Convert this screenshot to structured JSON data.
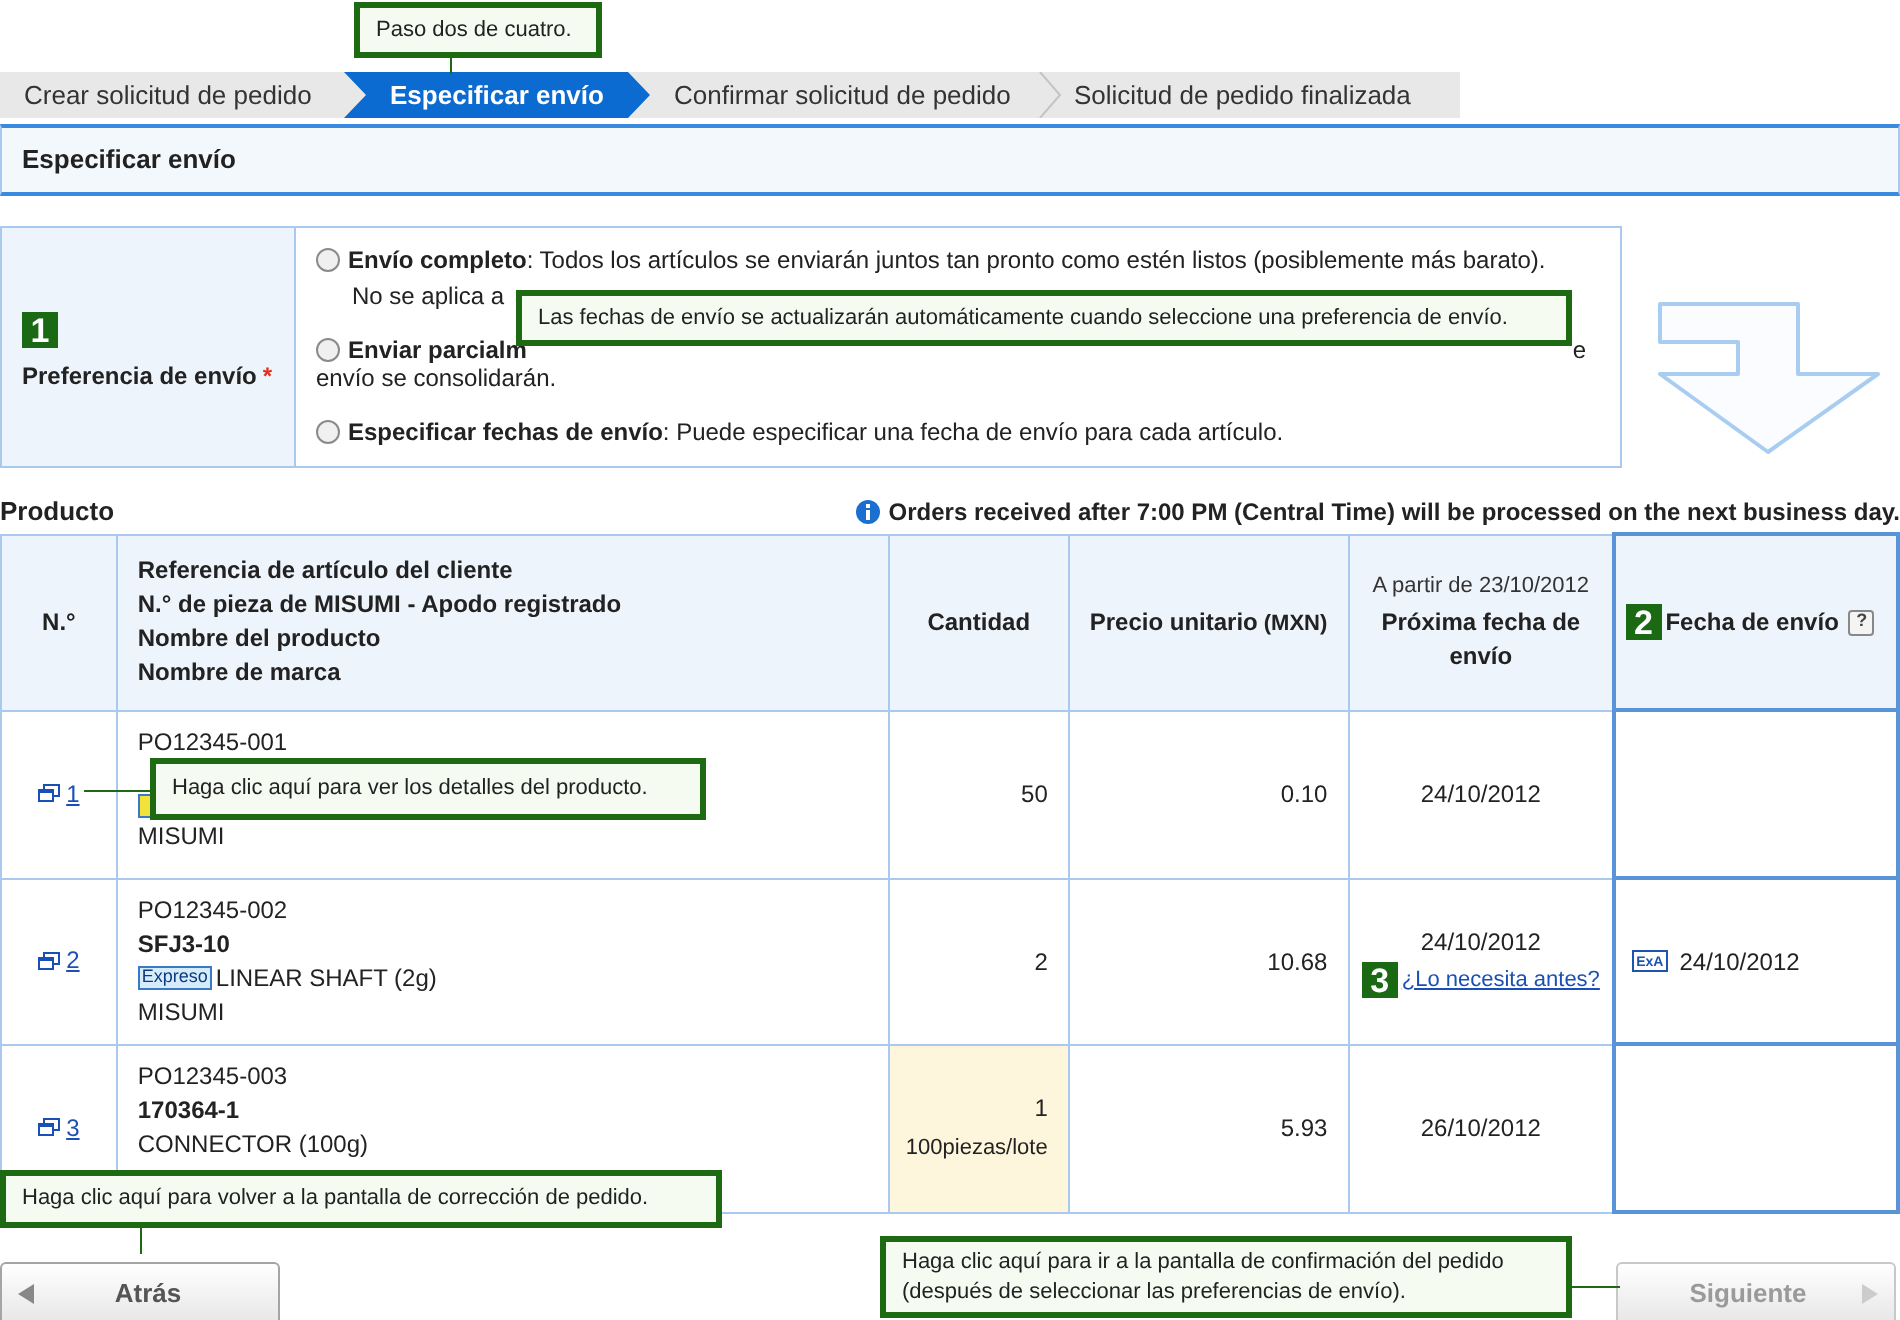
{
  "steps": [
    {
      "label": "Crear solicitud de pedido",
      "selected": false
    },
    {
      "label": "Especificar envío",
      "selected": true
    },
    {
      "label": "Confirmar solicitud de pedido",
      "selected": false
    },
    {
      "label": "Solicitud de pedido finalizada",
      "selected": false
    }
  ],
  "step_callout": "Paso dos de cuatro.",
  "section_title": "Especificar envío",
  "preference": {
    "marker": "1",
    "label": "Preferencia de envío",
    "required_mark": "*",
    "options": [
      {
        "kind": "full",
        "selected": false,
        "title": "Envío completo",
        "text": ": Todos los artículos se enviarán juntos tan pronto como estén listos (posiblemente más barato).",
        "note": "No se aplica a"
      },
      {
        "kind": "partial",
        "selected": false,
        "title": "Enviar parcialm",
        "tail": "e",
        "note": "envío se consolidarán."
      },
      {
        "kind": "dates",
        "selected": false,
        "title": "Especificar fechas de envío",
        "text": ": Puede especificar una fecha de envío para cada artículo."
      }
    ],
    "callout": "Las fechas de envío se actualizarán automáticamente cuando seleccione una preferencia de envío."
  },
  "table": {
    "title": "Producto",
    "notice": "Orders received after 7:00 PM (Central Time) will be processed on the next business day.",
    "columns": [
      {
        "lines": [
          "N.°"
        ]
      },
      {
        "lines": [
          "Referencia de artículo del cliente",
          "N.° de pieza de MISUMI - Apodo registrado",
          "Nombre del producto",
          "Nombre de marca"
        ]
      },
      {
        "lines": [
          "Cantidad"
        ]
      },
      {
        "lines": [
          "Precio unitario"
        ],
        "unit": "(MXN)"
      },
      {
        "note": "A partir de 23/10/2012",
        "lines": [
          "Próxima fecha de envío"
        ]
      },
      {
        "marker": "2",
        "lines": [
          "Fecha de envío"
        ],
        "help": "?"
      }
    ],
    "rows": [
      {
        "no": "1",
        "ref": "PO12345-001",
        "badge": {
          "color": "#f2e23c"
        },
        "brand": "MISUMI",
        "quantity": "50",
        "unit_price": "0.10",
        "next_date": "24/10/2012"
      },
      {
        "no": "2",
        "ref": "PO12345-002",
        "code": "SFJ3-10",
        "badge": {
          "text": "Expreso",
          "color": "#d6ecfb"
        },
        "name": "LINEAR SHAFT (2g)",
        "brand": "MISUMI",
        "quantity": "2",
        "unit_price": "10.68",
        "next_date": "24/10/2012",
        "marker": "3",
        "earlier_link": "¿Lo necesita antes?",
        "ship_icon": "ExA",
        "ship_date": "24/10/2012"
      },
      {
        "no": "3",
        "ref": "PO12345-003",
        "code": "170364-1",
        "name": "CONNECTOR (100g)",
        "quantity": "1",
        "lot": "100piezas/lote",
        "unit_price": "5.93",
        "next_date": "26/10/2012"
      }
    ],
    "row_callout": "Haga clic aquí para ver los detalles del producto."
  },
  "back": {
    "label": "Atrás",
    "disabled": false,
    "callout": "Haga clic aquí para volver a la pantalla de corrección de pedido."
  },
  "next": {
    "label": "Siguiente",
    "disabled": true,
    "callout": [
      "Haga clic aquí para ir a la pantalla de confirmación del pedido",
      "(después de seleccionar las preferencias de envío)."
    ]
  }
}
